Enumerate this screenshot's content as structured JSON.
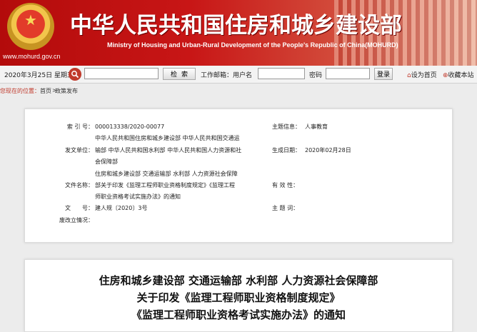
{
  "header": {
    "title_cn": "中华人民共和国住房和城乡建设部",
    "title_en": "Ministry of Housing and Urban-Rural Development of the People's Republic of China(MOHURD)",
    "site_url": "www.mohurd.gov.cn"
  },
  "toolbar": {
    "date": "2020年3月25日 星期三",
    "search_label": "检索",
    "workspace_label": "工作邮箱：用户名",
    "password_label": "密码",
    "login_label": "登录",
    "home_label": "设为首页",
    "favorite_label": "收藏本站"
  },
  "breadcrumb": {
    "label": "您现在的位置：",
    "home": "首页",
    "sep": ">",
    "current": "政策发布"
  },
  "meta": {
    "index_label": "索 引 号：",
    "index_value": "000013338/2020-00077",
    "topic_label": "主题信息：",
    "topic_value": "人事教育",
    "issuer_label": "发文单位：",
    "issuer_lines": [
      "中华人民共和国住房和城乡建设部 中华人民共和国交通运",
      "输部 中华人民共和国水利部 中华人民共和国人力资源和社",
      "会保障部"
    ],
    "date_label": "生成日期：",
    "date_value": "2020年02月28日",
    "filename_label": "文件名称：",
    "filename_lines": [
      "住房和城乡建设部 交通运输部 水利部 人力资源社会保障",
      "部关于印发《监理工程师职业资格制度规定》《监理工程",
      "师职业资格考试实施办法》的通知"
    ],
    "valid_label": "有 效 性：",
    "valid_value": "",
    "docno_label": "文　　号：",
    "docno_value": "建人规〔2020〕3号",
    "theme_label": "主 题 词：",
    "theme_value": "",
    "repeal_label": "废改立情况：",
    "repeal_value": ""
  },
  "document": {
    "title_lines": [
      "住房和城乡建设部 交通运输部 水利部 人力资源社会保障部",
      "关于印发《监理工程师职业资格制度规定》",
      "《监理工程师职业资格考试实施办法》的通知"
    ]
  },
  "colors": {
    "brand_red": "#c81616",
    "accent_red": "#c0392b"
  },
  "icons": [
    "emblem-icon",
    "search-icon",
    "home-icon",
    "favorite-icon"
  ]
}
